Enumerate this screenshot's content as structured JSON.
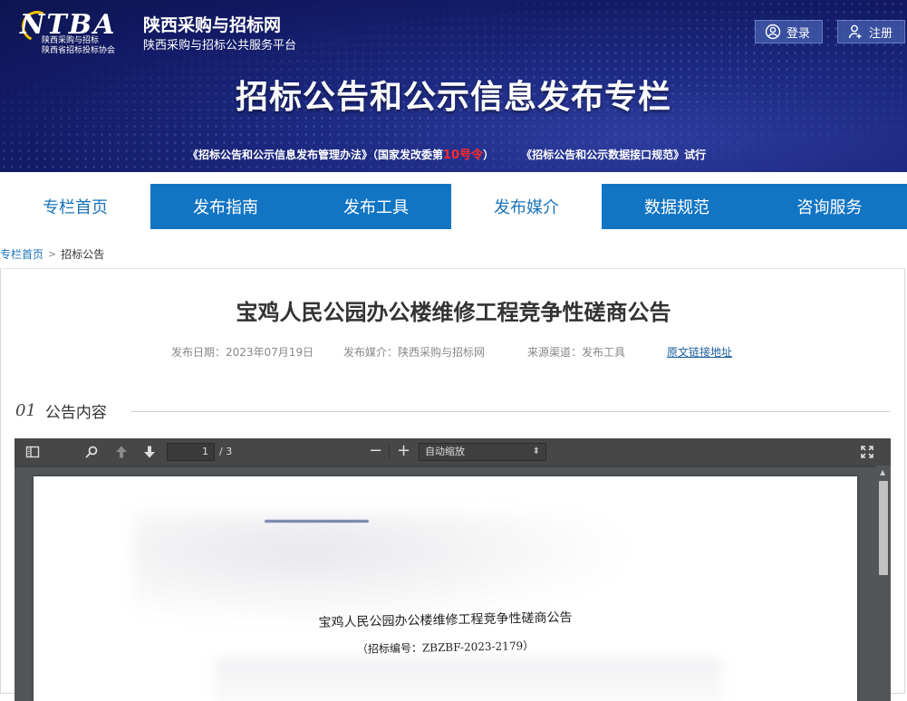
{
  "header": {
    "logo_mark": "NTBA",
    "logo_sub1": "陕西采购与招标",
    "logo_sub2": "陕西省招标投标协会",
    "site_name": "陕西采购与招标网",
    "site_sub": "陕西采购与招标公共服务平台",
    "login_label": "登录",
    "register_label": "注册",
    "banner_title": "招标公告和公示信息发布专栏",
    "note1_a": "《招标公告和公示信息发布管理办法》（国家发改委第",
    "note1_red": "10号令",
    "note1_b": "）",
    "note2": "《招标公告和公示数据接口规范》试行"
  },
  "nav": {
    "items": [
      {
        "label": "专栏首页"
      },
      {
        "label": "发布指南"
      },
      {
        "label": "发布工具"
      },
      {
        "label": "发布媒介"
      },
      {
        "label": "数据规范"
      },
      {
        "label": "咨询服务"
      }
    ]
  },
  "breadcrumb": {
    "home": "专栏首页",
    "sep": ">",
    "current": "招标公告"
  },
  "article": {
    "title": "宝鸡人民公园办公楼维修工程竞争性磋商公告",
    "publish_date": "发布日期：2023年07月19日",
    "publish_media": "发布媒介：陕西采购与招标网",
    "source_channel": "来源渠道：发布工具",
    "original_link": "原文链接地址",
    "section_num": "01",
    "section_label": "公告内容"
  },
  "pdf_viewer": {
    "page_current": "1",
    "page_total": "/ 3",
    "zoom_minus": "−",
    "zoom_plus": "+",
    "zoom_value": "自动缩放",
    "zoom_caret": "⬍",
    "scroll_up": "▲",
    "scroll_fraction": 0.4,
    "doc_title": "宝鸡人民公园办公楼维修工程竞争性磋商公告",
    "doc_code": "（招标编号：ZBZBF-2023-2179）"
  },
  "colors": {
    "nav_blue": "#1275c4",
    "nav_active_text": "#1a73b8",
    "banner_dark": "#121b66",
    "accent_red": "#ff2a2a"
  }
}
